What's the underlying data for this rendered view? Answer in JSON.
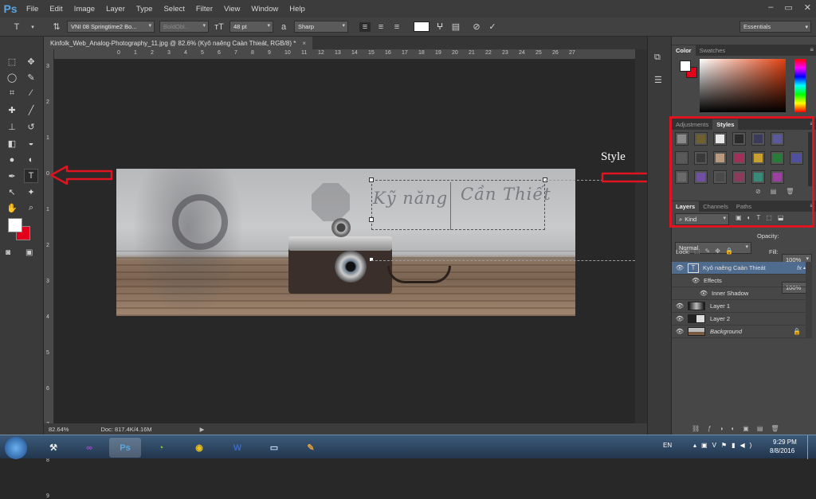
{
  "menubar": {
    "logo": "Ps",
    "items": [
      "File",
      "Edit",
      "Image",
      "Layer",
      "Type",
      "Select",
      "Filter",
      "View",
      "Window",
      "Help"
    ]
  },
  "options_bar": {
    "font_family": "VNI 08 Springtime2 Bo...",
    "font_style": "BoldObl...",
    "font_size": "48 pt",
    "antialias_label": "a",
    "antialias": "Sharp",
    "text_color": "#ffffff"
  },
  "workspace": "Essentials",
  "document": {
    "tab_title": "Kinfolk_Web_Analog-Photography_11.jpg @ 82.6% (Kyô naêng Caàn Thieát, RGB/8) *",
    "image_text_1": "Kỹ năng",
    "image_text_2": "Cần Thiết"
  },
  "rulers": {
    "top": [
      "0",
      "1",
      "2",
      "3",
      "4",
      "5",
      "6",
      "7",
      "8",
      "9",
      "10",
      "11",
      "12",
      "13",
      "14",
      "15",
      "16",
      "17",
      "18",
      "19",
      "20",
      "21",
      "22",
      "23",
      "24",
      "25",
      "26",
      "27"
    ],
    "left": [
      "3",
      "2",
      "1",
      "0",
      "1",
      "2",
      "3",
      "4",
      "5",
      "6",
      "7",
      "8",
      "9"
    ]
  },
  "status": {
    "zoom": "82.64%",
    "doc": "Doc: 817.4K/4.16M"
  },
  "annotation": {
    "label": "Style"
  },
  "color_panel": {
    "tabs": [
      "Color",
      "Swatches"
    ],
    "fg": "#ffffff",
    "bg": "#e3001b"
  },
  "tools": {
    "fg": "#ffffff",
    "bg": "#e3001b"
  },
  "styles_panel": {
    "tabs": [
      "Adjustments",
      "Styles"
    ],
    "swatches": [
      "#8a8a8a",
      "#6e6030",
      "#e8e8e8",
      "#2a2a2a",
      "#3a3a5a",
      "#5a5a9a",
      "#7a7a7a",
      "#5a5a5a",
      "#3a3a3a",
      "#b89a80",
      "#a0305a",
      "#c8a030",
      "#2a7a3a",
      "#5050a0",
      "#6a6a6a",
      "#7050a0",
      "#4a4a4a",
      "#8a3a5a",
      "#3a8a7a",
      "#9a40a0"
    ]
  },
  "layers_panel": {
    "tabs": [
      "Layers",
      "Channels",
      "Paths"
    ],
    "kind": "Kind",
    "blend_mode": "Normal",
    "opacity_label": "Opacity:",
    "opacity": "100%",
    "lock_label": "Lock:",
    "fill_label": "Fill:",
    "fill": "100%",
    "layers": [
      {
        "name": "Kyô naêng Caàn Thieát",
        "fx": "fx",
        "selected": true
      },
      {
        "name": "Effects"
      },
      {
        "name": "Inner Shadow"
      },
      {
        "name": "Layer 1"
      },
      {
        "name": "Layer 2"
      },
      {
        "name": "Background"
      }
    ]
  },
  "taskbar": {
    "lang": "EN",
    "time": "9:29 PM",
    "date": "8/8/2016"
  }
}
